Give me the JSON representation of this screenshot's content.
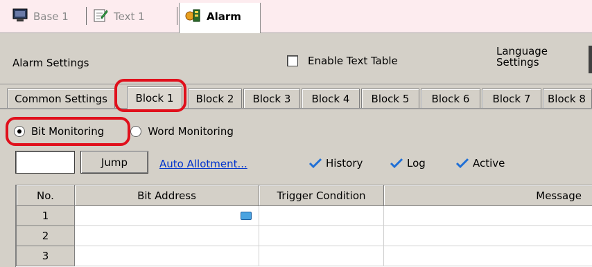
{
  "doc_tabs": [
    {
      "label": "Base 1",
      "icon": "monitor-icon"
    },
    {
      "label": "Text 1",
      "icon": "text-edit-icon"
    },
    {
      "label": "Alarm",
      "icon": "alarm-icon"
    }
  ],
  "settings": {
    "title": "Alarm Settings",
    "enable_text_table": "Enable Text Table",
    "enable_text_table_checked": false,
    "language_line1": "Language",
    "language_line2": "Settings"
  },
  "tabs": [
    "Common Settings",
    "Block 1",
    "Block 2",
    "Block 3",
    "Block 4",
    "Block 5",
    "Block 6",
    "Block 7",
    "Block 8"
  ],
  "active_tab": "Block 1",
  "monitoring": {
    "bit": "Bit Monitoring",
    "word": "Word Monitoring",
    "selected": "bit"
  },
  "jump": {
    "value": "",
    "button": "Jump",
    "auto_allotment": "Auto Allotment..."
  },
  "options": [
    {
      "label": "History",
      "checked": true
    },
    {
      "label": "Log",
      "checked": true
    },
    {
      "label": "Active",
      "checked": true
    }
  ],
  "table": {
    "headers": [
      "No.",
      "Bit Address",
      "Trigger Condition",
      "Message"
    ],
    "rows": [
      {
        "no": "1",
        "bit_address": "",
        "trigger": "",
        "message": ""
      },
      {
        "no": "2",
        "bit_address": "",
        "trigger": "",
        "message": ""
      },
      {
        "no": "3",
        "bit_address": "",
        "trigger": "",
        "message": ""
      }
    ]
  },
  "colors": {
    "highlight": "#e0101c",
    "link": "#0033cc",
    "check": "#1f6fd6"
  }
}
